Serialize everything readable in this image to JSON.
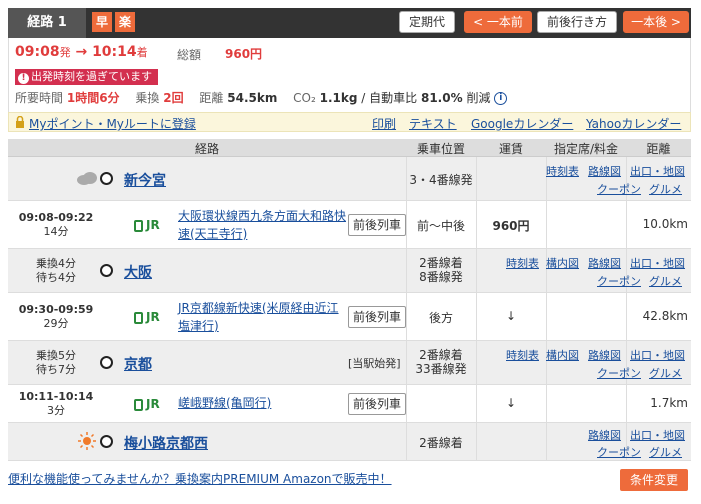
{
  "header": {
    "route_label": "経路 1",
    "badge_fast": "早",
    "badge_easy": "楽",
    "commuter_pass": "定期代",
    "prev_route": "< 一本前",
    "around_route": "前後行き方",
    "next_route": "一本後 >"
  },
  "summary": {
    "depart_time": "09:08",
    "depart_suffix": "発",
    "arrow": "→",
    "arrive_time": "10:14",
    "arrive_suffix": "着",
    "fare_label": "総額",
    "fare": "960円",
    "warning": "出発時刻を過ぎています",
    "duration_label": "所要時間",
    "duration": "1時間6分",
    "transfer_label": "乗換",
    "transfers": "2回",
    "distance_label": "距離",
    "distance": "54.5km",
    "co2_label": "CO₂",
    "co2": "1.1kg",
    "co2_compare": "/ 自動車比",
    "co2_percent": "81.0%",
    "co2_suffix": "削減"
  },
  "links": {
    "mypoint": "Myポイント・Myルートに登録",
    "print": "印刷",
    "text": "テキスト",
    "google_cal": "Googleカレンダー",
    "yahoo_cal": "Yahooカレンダー"
  },
  "table_headers": {
    "route": "経路",
    "position": "乗車位置",
    "fare": "運賃",
    "reserved": "指定席/料金",
    "distance": "距離"
  },
  "station_links": {
    "timetable": "時刻表",
    "route_map": "路線図",
    "station_map": "構内図",
    "exit_map": "出口・地図",
    "coupon": "クーポン",
    "gourmet": "グルメ"
  },
  "stations": [
    {
      "name": "新今宮",
      "platform": "3・4番線発",
      "weather": "cloud-icon"
    },
    {
      "name": "大阪",
      "transfer": "乗換4分",
      "wait": "待ち4分",
      "platform1": "2番線着",
      "platform2": "8番線発"
    },
    {
      "name": "京都",
      "transfer": "乗換5分",
      "wait": "待ち7分",
      "origin_note": "[当駅始発]",
      "platform1": "2番線着",
      "platform2": "33番線発"
    },
    {
      "name": "梅小路京都西",
      "platform": "2番線着",
      "weather": "sun-icon"
    }
  ],
  "segments": [
    {
      "time": "09:08-09:22",
      "duration": "14分",
      "company": "JR",
      "line": "大阪環状線西九条方面大和路快速(天王寺行)",
      "button": "前後列車",
      "position": "前～中後",
      "fare": "960円",
      "distance": "10.0km",
      "color": "#e2414b"
    },
    {
      "time": "09:30-09:59",
      "duration": "29分",
      "company": "JR",
      "line": "JR京都線新快速(米原経由近江塩津行)",
      "button": "前後列車",
      "position": "後方",
      "fare": "↓",
      "distance": "42.8km",
      "color": "#1f78c8"
    },
    {
      "time": "10:11-10:14",
      "duration": "3分",
      "company": "JR",
      "line": "嵯峨野線(亀岡行)",
      "button": "前後列車",
      "position": "",
      "fare": "↓",
      "distance": "1.7km",
      "color": "#8d4fb4"
    }
  ],
  "footer": {
    "promo": "便利な機能使ってみませんか？乗換案内PREMIUM Amazonで販売中！",
    "conditions": "条件変更"
  }
}
